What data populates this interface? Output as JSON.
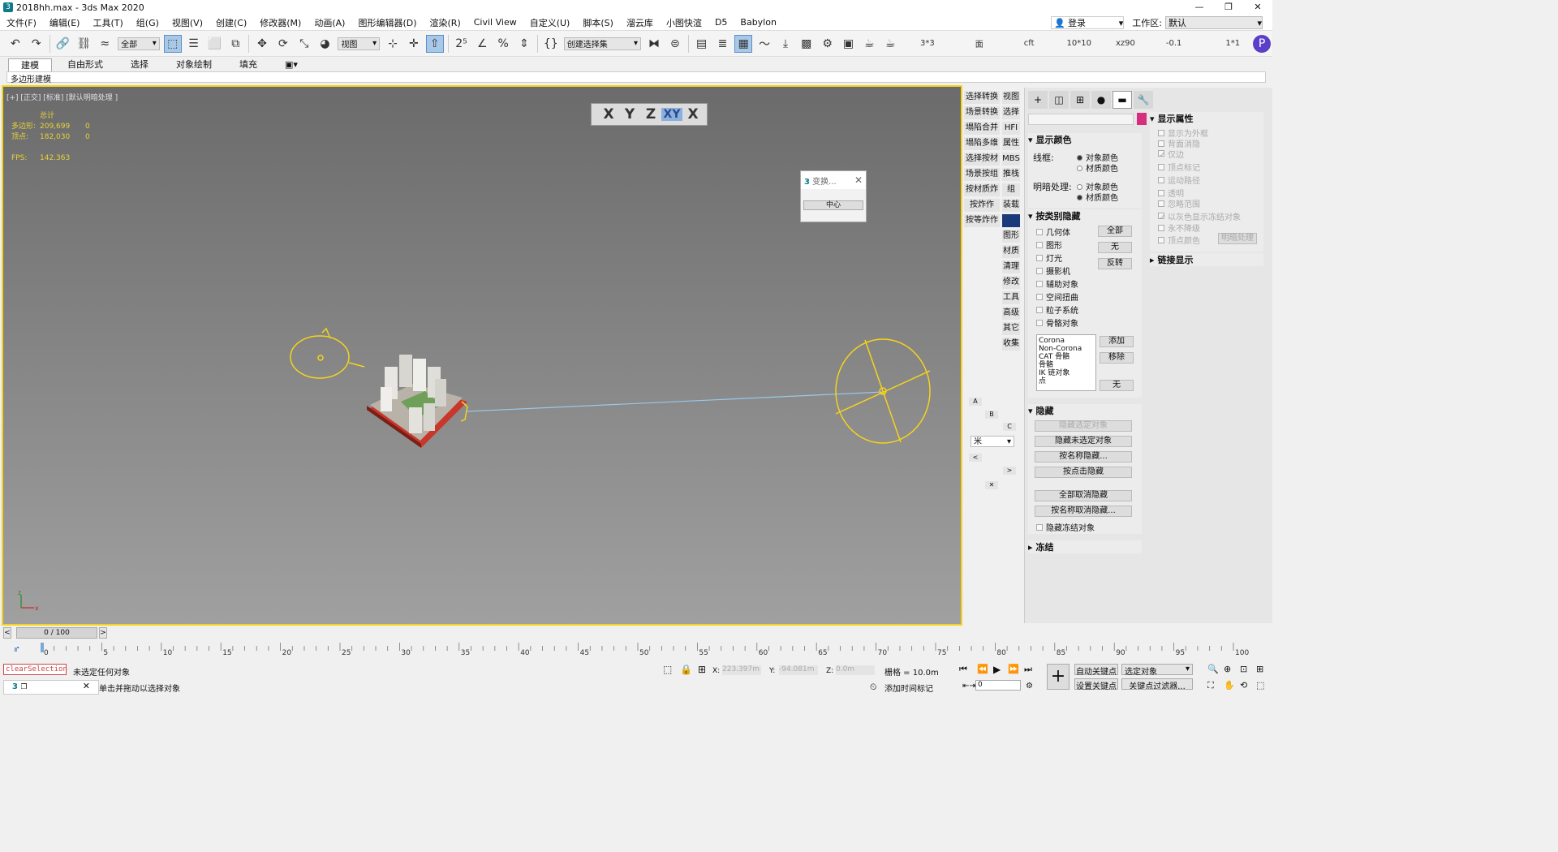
{
  "window": {
    "title": "2018hh.max - 3ds Max 2020",
    "icon": "3"
  },
  "menu": [
    "文件(F)",
    "编辑(E)",
    "工具(T)",
    "组(G)",
    "视图(V)",
    "创建(C)",
    "修改器(M)",
    "动画(A)",
    "图形编辑器(D)",
    "渲染(R)",
    "Civil View",
    "自定义(U)",
    "脚本(S)",
    "溜云库",
    "小图快渲",
    "D5",
    "Babylon"
  ],
  "login": "登录",
  "workspace": {
    "label": "工作区:",
    "value": "默认"
  },
  "toolbar": {
    "filter": "全部",
    "ref_coord": "视图",
    "named_sel": "创建选择集",
    "texts": [
      "3*3",
      "面",
      "cft",
      "10*10",
      "xz90",
      "-0.1",
      "1*1"
    ]
  },
  "ribbon": {
    "tabs": [
      "建模",
      "自由形式",
      "选择",
      "对象绘制",
      "填充"
    ],
    "sub": "多边形建模"
  },
  "viewport": {
    "label": "[+] [正交] [标准] [默认明暗处理 ]",
    "stats": {
      "header": "总计",
      "poly_label": "多边形:",
      "poly": "209,699",
      "poly_sel": "0",
      "vert_label": "顶点:",
      "vert": "182,030",
      "vert_sel": "0",
      "fps_label": "FPS:",
      "fps": "142.363"
    },
    "axes": [
      "X",
      "Y",
      "Z",
      "XY",
      "X"
    ]
  },
  "transform_dialog": {
    "title": "变换...",
    "button": "中心"
  },
  "strip": {
    "left": [
      "选择转换",
      "场景转换",
      "塌陷合并",
      "塌陷多维",
      "选择按材",
      "场景按组",
      "按材质炸",
      "按炸作",
      "按等炸作"
    ],
    "right": [
      "视图",
      "选择",
      "HFI",
      "属性",
      "MBS",
      "推栈",
      "组",
      "装载",
      "",
      "图形",
      "材质",
      "清理",
      "修改",
      "工具",
      "高级",
      "其它",
      "收集"
    ],
    "small": [
      "A",
      "B",
      "C",
      "米",
      "<",
      ">",
      "✕"
    ]
  },
  "cmd": {
    "display_color": {
      "title": "显示颜色",
      "wire": "线框:",
      "shade": "明暗处理:",
      "obj": "对象颜色",
      "mat": "材质颜色"
    },
    "hide_by_cat": {
      "title": "按类别隐藏",
      "items": [
        "几何体",
        "图形",
        "灯光",
        "摄影机",
        "辅助对象",
        "空间扭曲",
        "粒子系统",
        "骨骼对象"
      ],
      "btns": [
        "全部",
        "无",
        "反转"
      ],
      "list": [
        "Corona",
        "Non-Corona",
        "CAT 骨骼",
        "骨骼",
        "IK 链对象",
        "点"
      ],
      "list_btns": [
        "添加",
        "移除",
        "无"
      ]
    },
    "hide": {
      "title": "隐藏",
      "btns": [
        "隐藏选定对象",
        "隐藏未选定对象",
        "按名称隐藏...",
        "按点击隐藏",
        "全部取消隐藏",
        "按名称取消隐藏...",
        "隐藏冻结对象"
      ]
    },
    "freeze": "冻结",
    "display_props": {
      "title": "显示属性",
      "items": [
        "显示为外框",
        "背面消隐",
        "仅边",
        "顶点标记",
        "运动路径",
        "透明",
        "忽略范围",
        "以灰色显示冻结对象",
        "永不降级",
        "顶点颜色"
      ],
      "btn": "明暗处理"
    },
    "link_display": "链接显示"
  },
  "timeline": {
    "frame": "0 / 100",
    "ticks": [
      "0",
      "5",
      "10",
      "15",
      "20",
      "25",
      "30",
      "35",
      "40",
      "45",
      "50",
      "55",
      "60",
      "65",
      "70",
      "75",
      "80",
      "85",
      "90",
      "95",
      "100"
    ]
  },
  "status": {
    "script": "clearSelection",
    "msg1": "未选定任何对象",
    "msg2": "单击并拖动以选择对象",
    "x_label": "X:",
    "x": "223.397m",
    "y_label": "Y:",
    "y": "-94.081m",
    "z_label": "Z:",
    "z": "0.0m",
    "grid": "栅格 = 10.0m",
    "add_time_tag": "添加时间标记",
    "auto_key": "自动关键点",
    "set_key": "设置关键点",
    "sel_obj": "选定对象",
    "key_filter": "关键点过滤器...",
    "frame_value": "0"
  },
  "colors": {
    "accent": "#f5d31c",
    "stats": "#e8d238",
    "swatch": "#d62d7e",
    "strip_swatch": "#1a3a7a"
  }
}
